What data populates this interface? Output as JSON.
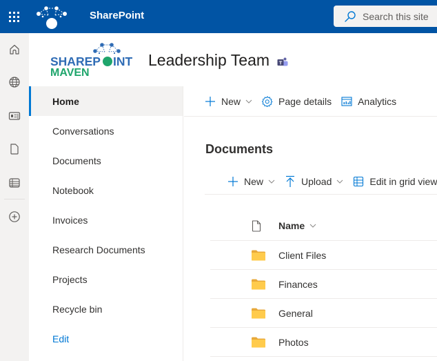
{
  "suitebar": {
    "app_name": "SharePoint",
    "search_placeholder": "Search this site",
    "background_color": "#0154a4"
  },
  "appbar": {
    "items": [
      {
        "icon": "home-icon",
        "label": "Home"
      },
      {
        "icon": "globe-icon",
        "label": "My sites"
      },
      {
        "icon": "news-icon",
        "label": "My news"
      },
      {
        "icon": "file-icon",
        "label": "My files"
      },
      {
        "icon": "lists-icon",
        "label": "My lists"
      },
      {
        "icon": "add-circle-icon",
        "label": "Create"
      }
    ]
  },
  "site": {
    "logo_line1_a": "SHAREP",
    "logo_line1_b": "INT",
    "logo_line2": "MAVEN",
    "title": "Leadership Team",
    "teams_icon": "teams-icon"
  },
  "leftnav": {
    "items": [
      {
        "label": "Home",
        "selected": true
      },
      {
        "label": "Conversations"
      },
      {
        "label": "Documents"
      },
      {
        "label": "Notebook"
      },
      {
        "label": "Invoices"
      },
      {
        "label": "Research Documents"
      },
      {
        "label": "Projects"
      },
      {
        "label": "Recycle bin"
      }
    ],
    "edit_label": "Edit"
  },
  "page_commands": {
    "new_label": "New",
    "page_details_label": "Page details",
    "analytics_label": "Analytics"
  },
  "documents": {
    "title": "Documents",
    "commands": {
      "new_label": "New",
      "upload_label": "Upload",
      "grid_label": "Edit in grid view"
    },
    "columns": {
      "name_label": "Name"
    },
    "rows": [
      {
        "name": "Client Files",
        "type": "folder"
      },
      {
        "name": "Finances",
        "type": "folder"
      },
      {
        "name": "General",
        "type": "folder"
      },
      {
        "name": "Photos",
        "type": "folder"
      }
    ]
  },
  "colors": {
    "accent": "#0078d4",
    "folder": "#ffc83d",
    "logo_blue": "#2f6cb5",
    "logo_green": "#1fa56c"
  }
}
